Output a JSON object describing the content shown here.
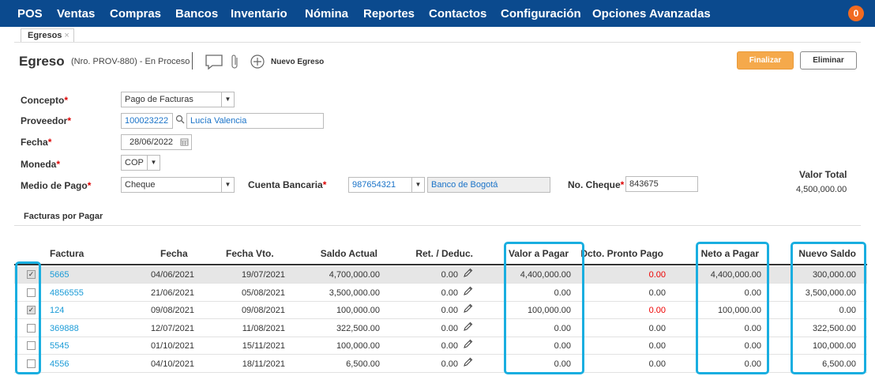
{
  "nav": {
    "items": [
      "POS",
      "Ventas",
      "Compras",
      "Bancos",
      "Inventario",
      "Nómina",
      "Reportes",
      "Contactos",
      "Configuración",
      "Opciones Avanzadas"
    ],
    "notification_count": "0"
  },
  "tab": {
    "label": "Egresos",
    "close": "×"
  },
  "header": {
    "title": "Egreso",
    "subtitle": "(Nro. PROV-880) - En Proceso",
    "new_label": "Nuevo Egreso",
    "finalize_label": "Finalizar",
    "delete_label": "Eliminar"
  },
  "form": {
    "concepto": {
      "label": "Concepto",
      "value": "Pago de Facturas"
    },
    "proveedor": {
      "label": "Proveedor",
      "code": "100023222",
      "name": "Lucía Valencia"
    },
    "fecha": {
      "label": "Fecha",
      "value": "28/06/2022"
    },
    "moneda": {
      "label": "Moneda",
      "value": "COP"
    },
    "medio_pago": {
      "label": "Medio de Pago",
      "value": "Cheque"
    },
    "cuenta_bancaria": {
      "label": "Cuenta Bancaria",
      "code": "987654321",
      "name": "Banco de Bogotá"
    },
    "no_cheque": {
      "label": "No. Cheque",
      "value": "843675"
    },
    "required_mark": "*",
    "valor_total": {
      "label": "Valor Total",
      "value": "4,500,000.00"
    }
  },
  "section_title": "Facturas por Pagar",
  "table": {
    "columns": [
      "Factura",
      "Fecha",
      "Fecha Vto.",
      "Saldo Actual",
      "Ret. / Deduc.",
      "Valor a Pagar",
      "Dcto. Pronto Pago",
      "Neto a Pagar",
      "Nuevo Saldo"
    ],
    "rows": [
      {
        "checked": true,
        "factura": "5665",
        "fecha": "04/06/2021",
        "vto": "19/07/2021",
        "saldo": "4,700,000.00",
        "ret": "0.00",
        "valor": "4,400,000.00",
        "dcto": "0.00",
        "dcto_red": true,
        "neto": "4,400,000.00",
        "nuevo": "300,000.00"
      },
      {
        "checked": false,
        "factura": "4856555",
        "fecha": "21/06/2021",
        "vto": "05/08/2021",
        "saldo": "3,500,000.00",
        "ret": "0.00",
        "valor": "0.00",
        "dcto": "0.00",
        "dcto_red": false,
        "neto": "0.00",
        "nuevo": "3,500,000.00"
      },
      {
        "checked": true,
        "factura": "124",
        "fecha": "09/08/2021",
        "vto": "09/08/2021",
        "saldo": "100,000.00",
        "ret": "0.00",
        "valor": "100,000.00",
        "dcto": "0.00",
        "dcto_red": true,
        "neto": "100,000.00",
        "nuevo": "0.00"
      },
      {
        "checked": false,
        "factura": "369888",
        "fecha": "12/07/2021",
        "vto": "11/08/2021",
        "saldo": "322,500.00",
        "ret": "0.00",
        "valor": "0.00",
        "dcto": "0.00",
        "dcto_red": false,
        "neto": "0.00",
        "nuevo": "322,500.00"
      },
      {
        "checked": false,
        "factura": "5545",
        "fecha": "01/10/2021",
        "vto": "15/11/2021",
        "saldo": "100,000.00",
        "ret": "0.00",
        "valor": "0.00",
        "dcto": "0.00",
        "dcto_red": false,
        "neto": "0.00",
        "nuevo": "100,000.00"
      },
      {
        "checked": false,
        "factura": "4556",
        "fecha": "04/10/2021",
        "vto": "18/11/2021",
        "saldo": "6,500.00",
        "ret": "0.00",
        "valor": "0.00",
        "dcto": "0.00",
        "dcto_red": false,
        "neto": "0.00",
        "nuevo": "6,500.00"
      }
    ]
  },
  "colors": {
    "nav_bg": "#0b4a8e",
    "accent": "#f5a94b",
    "highlight": "#19aee0",
    "link": "#1a9bd7",
    "alert": "#e00000"
  },
  "icons": [
    "comment-icon",
    "paperclip-icon",
    "plus-circle-icon",
    "search-icon",
    "calendar-icon",
    "pencil-icon",
    "chevron-down-icon"
  ]
}
